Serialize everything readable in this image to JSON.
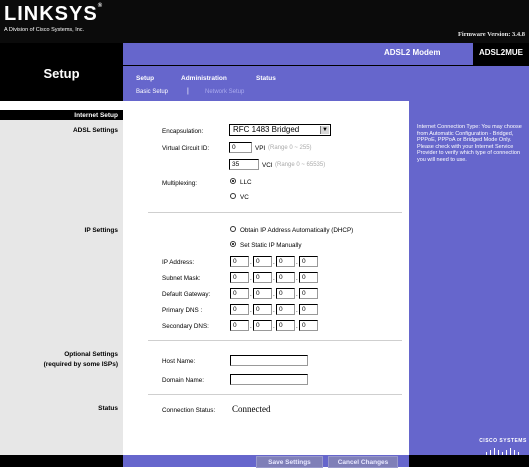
{
  "brand": {
    "logo": "LINKSYS",
    "logo_mark": "®",
    "tagline": "A Division of Cisco Systems, Inc.",
    "firmware": "Firmware Version: 3.4.8"
  },
  "header": {
    "section_title": "Setup",
    "model_name": "ADSL2 Modem",
    "model_id": "ADSL2MUE"
  },
  "tabs": [
    {
      "label": "Setup",
      "active": true
    },
    {
      "label": "Administration",
      "active": false
    },
    {
      "label": "Status",
      "active": false
    }
  ],
  "subtabs": [
    {
      "label": "Basic Setup",
      "active": true
    },
    {
      "label": "Network Setup",
      "active": false
    }
  ],
  "subtab_separator": "|",
  "sidebar": {
    "internet_setup": "Internet Setup",
    "adsl_settings": "ADSL Settings",
    "ip_settings": "IP Settings",
    "optional_settings_line1": "Optional Settings",
    "optional_settings_line2": "(required by some ISPs)",
    "status": "Status"
  },
  "adsl": {
    "encapsulation_label": "Encapsulation:",
    "encapsulation_value": "RFC 1483 Bridged",
    "vci_circuit_label": "Virtual Circuit ID:",
    "vpi_value": "0",
    "vpi_label": "VPI",
    "vpi_range": "(Range 0 ~ 255)",
    "vci_value": "35",
    "vci_label": "VCI",
    "vci_range": "(Range 0 ~ 65535)",
    "multiplexing_label": "Multiplexing:",
    "mux_llc": "LLC",
    "mux_vc": "VC",
    "mux_selected": "LLC"
  },
  "ip": {
    "dhcp_option": "Obtain IP Address Automatically (DHCP)",
    "static_option": "Set Static IP Manually",
    "selected": "static",
    "fields": [
      {
        "label": "IP Address:",
        "octets": [
          "0",
          "0",
          "0",
          "0"
        ]
      },
      {
        "label": "Subnet Mask:",
        "octets": [
          "0",
          "0",
          "0",
          "0"
        ]
      },
      {
        "label": "Default Gateway:",
        "octets": [
          "0",
          "0",
          "0",
          "0"
        ]
      },
      {
        "label": "Primary DNS :",
        "octets": [
          "0",
          "0",
          "0",
          "0"
        ]
      },
      {
        "label": "Secondary DNS:",
        "octets": [
          "0",
          "0",
          "0",
          "0"
        ]
      }
    ],
    "dot": "."
  },
  "optional": {
    "host_label": "Host Name:",
    "host_value": "",
    "domain_label": "Domain Name:",
    "domain_value": ""
  },
  "status": {
    "connection_label": "Connection Status:",
    "connection_value": "Connected"
  },
  "help": {
    "text": "Internet Connection Type: You may choose from Automatic Configuration - Bridged, PPPoE, PPPoA or Bridged Mode Only. Please check with your Internet Service Provider to verify which type of connection you will need to use."
  },
  "footer": {
    "save_label": "Save Settings",
    "cancel_label": "Cancel Changes",
    "cisco_logo": "CISCO SYSTEMS"
  },
  "colors": {
    "accent": "#6666cc",
    "header_bg": "#0b0b0b",
    "sidebar_bg": "#e7e7e7"
  }
}
